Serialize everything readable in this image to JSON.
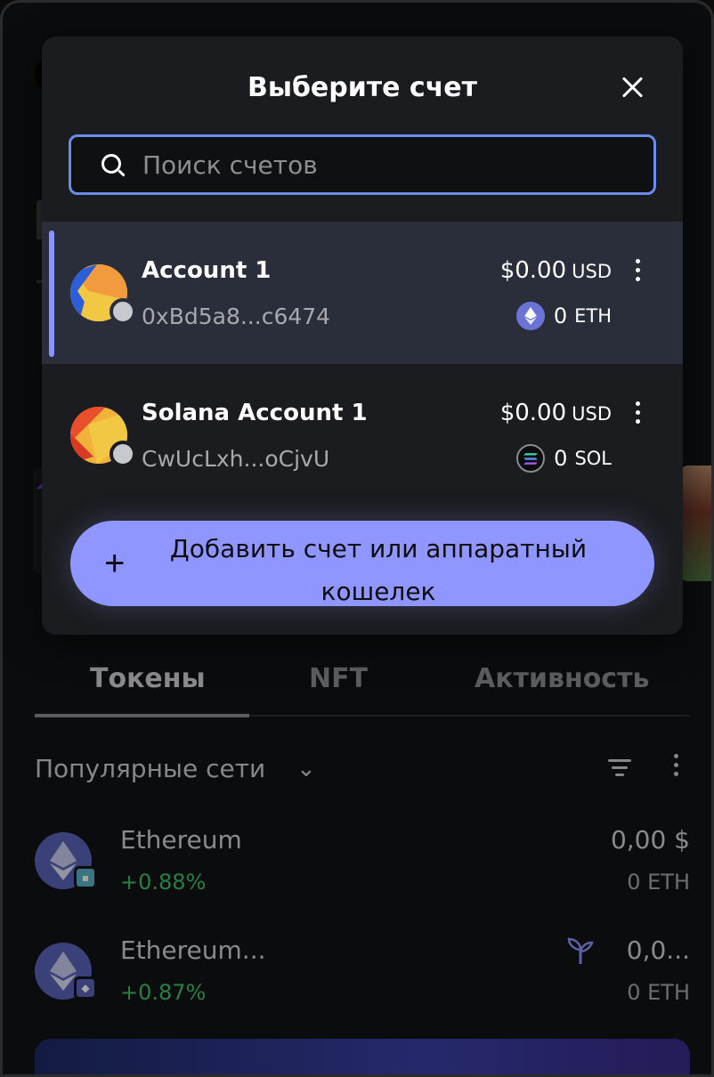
{
  "modal": {
    "title": "Выберите счет",
    "search_placeholder": "Поиск счетов",
    "accounts": [
      {
        "name": "Account 1",
        "address": "0xBd5a8...c6474",
        "balance": "$0.00",
        "currency": "USD",
        "crypto_amount": "0",
        "crypto_ticker": "ETH",
        "chain_icon": "ethereum-icon",
        "selected": true
      },
      {
        "name": "Solana Account 1",
        "address": "CwUcLxh...oCjvU",
        "balance": "$0.00",
        "currency": "USD",
        "crypto_amount": "0",
        "crypto_ticker": "SOL",
        "chain_icon": "solana-icon",
        "selected": false
      }
    ],
    "add_button_label": "Добавить счет или аппаратный кошелек"
  },
  "tabs": [
    {
      "label": "Токены",
      "active": true
    },
    {
      "label": "NFT",
      "active": false
    },
    {
      "label": "Активность",
      "active": false
    }
  ],
  "networks": {
    "label": "Популярные сети"
  },
  "tokens": [
    {
      "name": "Ethereum",
      "change": "+0.88%",
      "value": "0,00 $",
      "amount": "0 ETH",
      "icon": "ethereum-icon",
      "badge": "network-badge"
    },
    {
      "name": "Ethereum...",
      "change": "+0.87%",
      "value": "0,0...",
      "amount": "0 ETH",
      "icon": "ethereum-icon",
      "badge": "ethereum-badge",
      "extra_icon": "sprout-icon"
    }
  ],
  "colors": {
    "accent": "#8f96ff",
    "positive": "#3ec36b",
    "search_border": "#6b8ce8",
    "modal_bg": "#1b1c1f",
    "selected_bg": "#2a2d3a"
  }
}
